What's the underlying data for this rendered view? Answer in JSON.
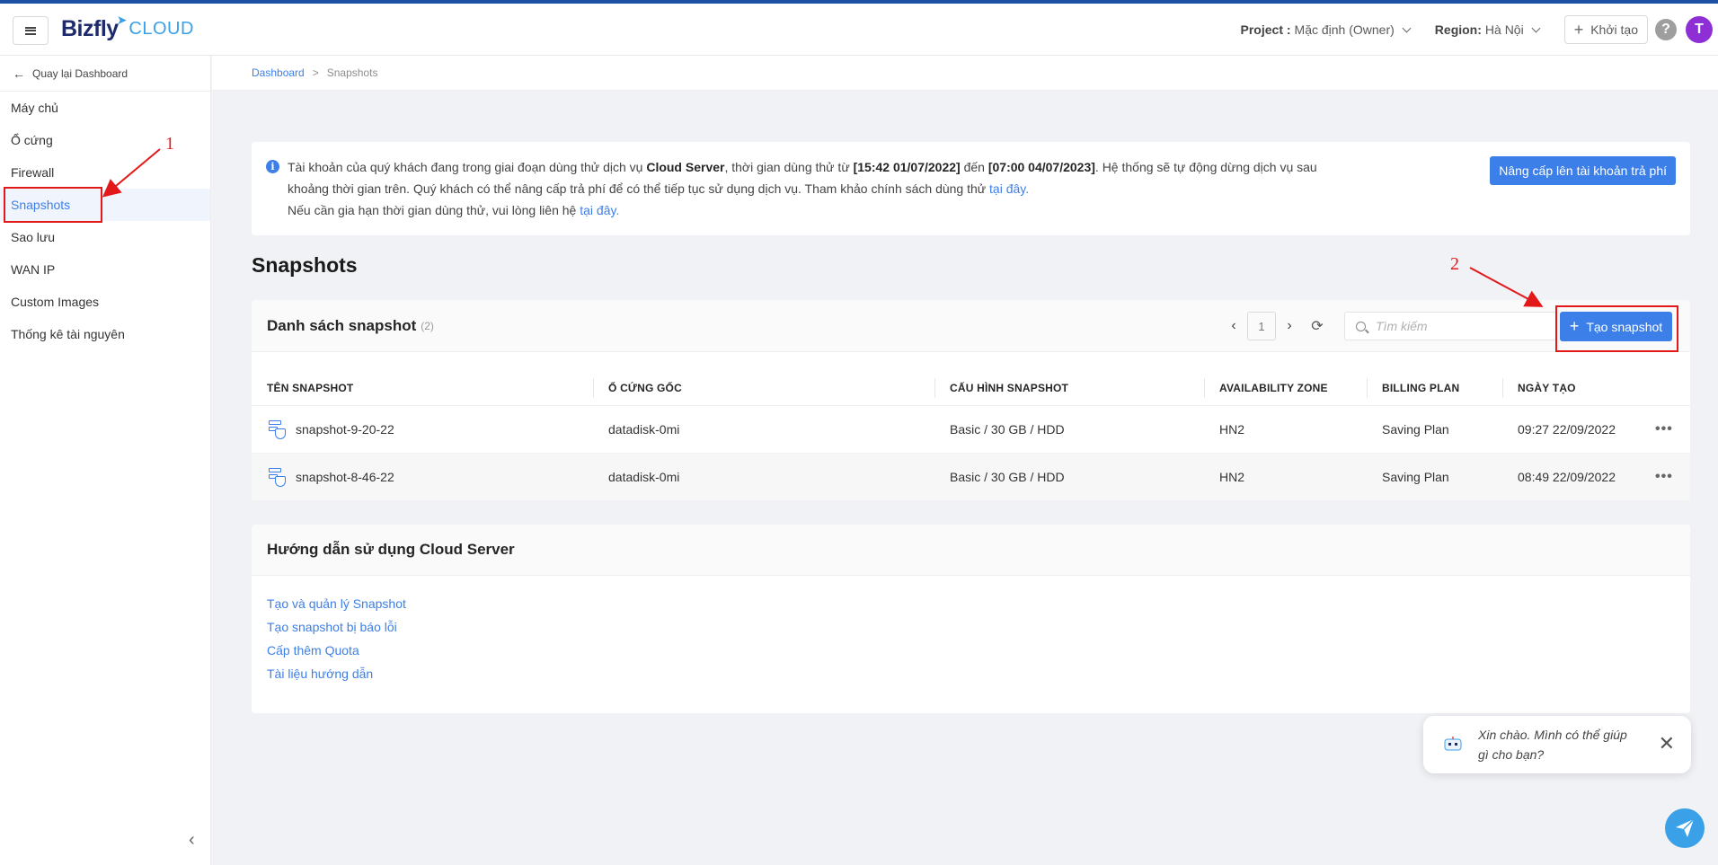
{
  "header": {
    "logo_brand": "Bizfly",
    "logo_suffix": "CLOUD",
    "project_label": "Project :",
    "project_value": "Mặc định (Owner)",
    "region_label": "Region:",
    "region_value": "Hà Nội",
    "create_label": "Khởi tạo",
    "help_glyph": "?",
    "avatar_initial": "T"
  },
  "sidebar": {
    "back_label": "Quay lại Dashboard",
    "items": [
      {
        "label": "Máy chủ"
      },
      {
        "label": "Ổ cứng"
      },
      {
        "label": "Firewall"
      },
      {
        "label": "Snapshots"
      },
      {
        "label": "Sao lưu"
      },
      {
        "label": "WAN IP"
      },
      {
        "label": "Custom Images"
      },
      {
        "label": "Thống kê tài nguyên"
      }
    ],
    "active_index": 3
  },
  "breadcrumb": {
    "items": [
      "Dashboard",
      "Snapshots"
    ],
    "separator": ">"
  },
  "notice": {
    "line1_part1": "Tài khoản của quý khách đang trong giai đoạn dùng thử dịch vụ ",
    "line1_bold1": "Cloud Server",
    "line1_part2": ", thời gian dùng thử từ ",
    "line1_bold2": "[15:42 01/07/2022]",
    "line1_part3": " đến ",
    "line1_bold3": "[07:00 04/07/2023]",
    "line1_part4": ". Hệ thống sẽ tự động dừng dịch vụ sau khoảng thời gian trên. Quý khách có thể nâng cấp trả phí để có thể tiếp tục sử dụng dịch vụ. Tham khảo chính sách dùng thử ",
    "line1_link": "tại đây.",
    "line2_text": "Nếu cần gia hạn thời gian dùng thử, vui lòng liên hệ ",
    "line2_link": "tại đây.",
    "upgrade_label": "Nâng cấp lên tài khoản trả phí"
  },
  "page_title": "Snapshots",
  "snapshot_list": {
    "title": "Danh sách snapshot",
    "count": "(2)",
    "page": "1",
    "search_placeholder": "Tìm kiếm",
    "create_label": "Tạo snapshot",
    "columns": [
      "TÊN SNAPSHOT",
      "Ổ CỨNG GỐC",
      "CẤU HÌNH SNAPSHOT",
      "AVAILABILITY ZONE",
      "BILLING PLAN",
      "NGÀY TẠO"
    ],
    "rows": [
      {
        "name": "snapshot-9-20-22",
        "disk": "datadisk-0mi",
        "config": "Basic / 30 GB / HDD",
        "zone": "HN2",
        "plan": "Saving Plan",
        "created": "09:27 22/09/2022"
      },
      {
        "name": "snapshot-8-46-22",
        "disk": "datadisk-0mi",
        "config": "Basic / 30 GB / HDD",
        "zone": "HN2",
        "plan": "Saving Plan",
        "created": "08:49 22/09/2022"
      }
    ]
  },
  "guide": {
    "title": "Hướng dẫn sử dụng Cloud Server",
    "links": [
      "Tạo và quản lý Snapshot",
      "Tạo snapshot bị báo lỗi",
      "Cấp thêm Quota",
      "Tài liệu hướng dẫn"
    ]
  },
  "annotations": {
    "step1": "1",
    "step2": "2",
    "color": "#e31919"
  },
  "chat": {
    "message": "Xin chào. Mình có thể giúp gì cho bạn?"
  },
  "colors": {
    "primary": "#3d7fe8",
    "brand_dark": "#1d2a6b",
    "brand_light": "#3aa0e8",
    "avatar": "#8e2fd6"
  }
}
